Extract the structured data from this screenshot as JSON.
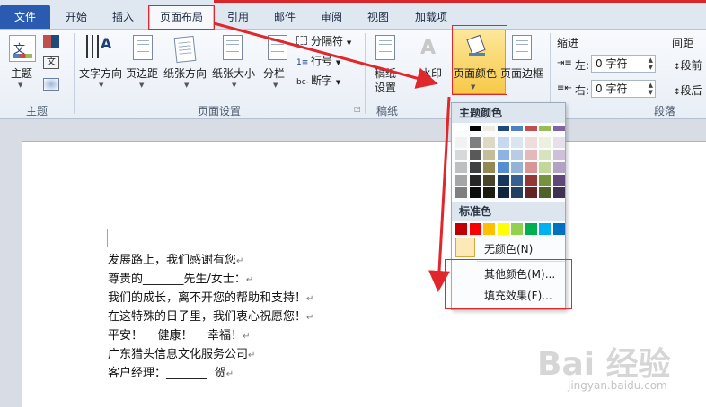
{
  "tabs": [
    "文件",
    "开始",
    "插入",
    "页面布局",
    "引用",
    "邮件",
    "审阅",
    "视图",
    "加载项"
  ],
  "ribbon": {
    "theme_group": {
      "label": "主题",
      "btn": "主题"
    },
    "page_setup": {
      "label": "页面设置",
      "text_direction": "文字方向",
      "margins": "页边距",
      "orientation": "纸张方向",
      "size": "纸张大小",
      "columns": "分栏",
      "breaks": "分隔符",
      "line_numbers": "行号",
      "hyphenation": "断字"
    },
    "draft_group": {
      "label": "稿纸",
      "btn_line1": "稿纸",
      "btn_line2": "设置"
    },
    "page_bg": {
      "watermark": "水印",
      "page_color": "页面颜色",
      "page_border": "页面边框"
    },
    "indent": {
      "title": "缩进",
      "left_label": "左:",
      "left_value": "0 字符",
      "right_label": "右:",
      "right_value": "0 字符"
    },
    "spacing": {
      "title": "间距",
      "before": "段前",
      "after": "段后"
    },
    "paragraph_label": "段落"
  },
  "dropdown": {
    "theme_colors": "主题颜色",
    "standard_colors": "标准色",
    "no_color": "无颜色(N)",
    "more_colors": "其他颜色(M)...",
    "fill_effects": "填充效果(F)...",
    "theme_top_colors": [
      "#ffffff",
      "#000000",
      "#eeece1",
      "#1f497d",
      "#4f81bd",
      "#c0504d",
      "#9bbb59",
      "#8064a2"
    ],
    "theme_shades": [
      [
        "#f2f2f2",
        "#7f7f7f",
        "#ddd9c3",
        "#c6d9f0",
        "#dbe5f1",
        "#f2dcdb",
        "#ebf1dd",
        "#e5e0ec"
      ],
      [
        "#d8d8d8",
        "#595959",
        "#c4bd97",
        "#8db3e2",
        "#b8cce4",
        "#e5b9b7",
        "#d7e3bc",
        "#ccc1d9"
      ],
      [
        "#bfbfbf",
        "#3f3f3f",
        "#938953",
        "#548dd4",
        "#95b3d7",
        "#d99694",
        "#c3d69b",
        "#b2a2c7"
      ],
      [
        "#a5a5a5",
        "#262626",
        "#494429",
        "#17365d",
        "#366092",
        "#953734",
        "#76923c",
        "#5f497a"
      ],
      [
        "#7f7f7f",
        "#0c0c0c",
        "#1d1b10",
        "#0f243e",
        "#244061",
        "#632423",
        "#4f6128",
        "#3f3151"
      ]
    ],
    "standard": [
      "#c00000",
      "#ff0000",
      "#ffc000",
      "#ffff00",
      "#92d050",
      "#00b050",
      "#00b0f0",
      "#0070c0"
    ]
  },
  "document": {
    "lines": [
      "发展路上，我们感谢有您",
      "尊贵的_______先生/女士：",
      "我们的成长，离不开您的帮助和支持！",
      "在这特殊的日子里，我们衷心祝愿您！",
      "平安！    健康！    幸福！",
      "广东猎头信息文化服务公司",
      "客户经理：_______  贺"
    ]
  },
  "watermark": {
    "logo": "Bai  经验",
    "url": "jingyan.baidu.com"
  }
}
